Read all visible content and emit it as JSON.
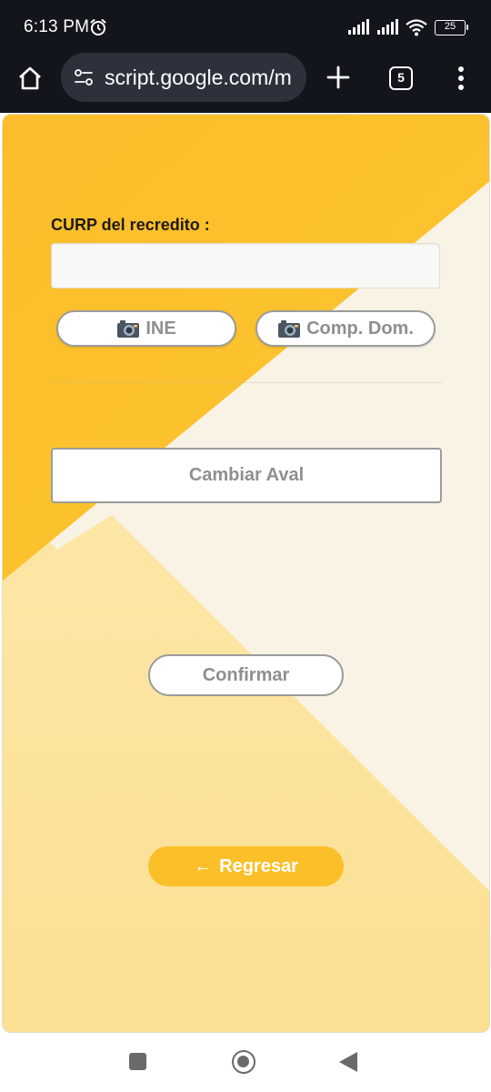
{
  "status_bar": {
    "time": "6:13 PM",
    "battery": "25",
    "icons": [
      "alarm-icon",
      "signal-icon",
      "signal-icon",
      "wifi-icon",
      "battery-icon"
    ]
  },
  "browser": {
    "url": "script.google.com/m",
    "tab_count": "5",
    "icons": [
      "home-icon",
      "site-settings-icon",
      "plus-icon",
      "tabs-icon",
      "more-vert-icon"
    ]
  },
  "form": {
    "curp_label": "CURP del recredito :",
    "curp_value": "",
    "ine_button": "INE",
    "comp_dom_button": "Comp. Dom.",
    "cambiar_aval_button": "Cambiar Aval",
    "confirmar_button": "Confirmar",
    "regresar_button": "Regresar",
    "back_arrow": "←"
  },
  "colors": {
    "accent": "#fbbf2a",
    "background_cream": "#f9f3e6",
    "background_light_yellow": "#fbe098",
    "button_text": "#8f8f8f"
  },
  "nav_bar": {
    "icons": [
      "recents-icon",
      "home-circle-icon",
      "back-triangle-icon"
    ]
  }
}
